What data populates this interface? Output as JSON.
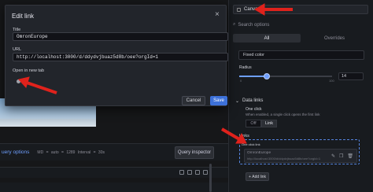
{
  "modal": {
    "title": "Edit link",
    "close_glyph": "×",
    "title_label": "Title",
    "title_value": "OmronEurope",
    "url_label": "URL",
    "url_value": "http://localhost:3000/d/ddydvjbuaz5d8b/oee?orgId=1",
    "new_tab_label": "Open in new tab",
    "cancel_label": "Cancel",
    "save_label": "Save"
  },
  "query_bar": {
    "options_label": "uery options",
    "meta": "MD = auto = 1289   Interval = 30s",
    "inspector_label": "Query inspector"
  },
  "pane": {
    "viz_name": "Canvas",
    "search_placeholder": "Search options",
    "tabs": [
      "All",
      "Overrides"
    ],
    "color_mode": "Fixed color",
    "radius_label": "Radius",
    "radius_value": "14",
    "radius_fraction": 0.3,
    "slider_min": "0",
    "slider_max": "100",
    "data_links_label": "Data links",
    "one_click_label": "One click",
    "one_click_desc": "When enabled, a single click opens the first link",
    "one_click_options": [
      "Off",
      "Link"
    ],
    "links_label": "Links",
    "one_click_tag": "One click link",
    "link_title": "OmronEurope",
    "link_url": "http://localhost:3000/d/ddydvjbuaz5d8b/oee?orgId=1",
    "add_link_label": "Add link"
  },
  "colors": {
    "accent_blue": "#3d71d9",
    "annotation_red": "#e0221c"
  },
  "icons": [
    "close-icon",
    "search-icon",
    "chevron-down-icon",
    "edit-icon",
    "copy-icon",
    "trash-icon",
    "plus-icon"
  ]
}
